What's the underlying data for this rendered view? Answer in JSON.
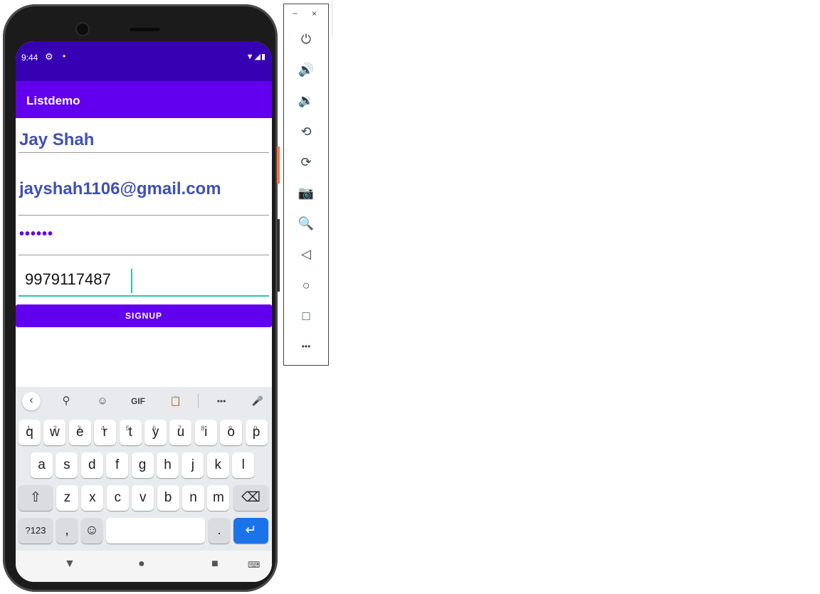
{
  "status_bar": {
    "time": "9:44",
    "settings_icon": "gear-icon",
    "dot": "•",
    "right_icons": "▼◢▮"
  },
  "app_bar": {
    "title": "Listdemo"
  },
  "form": {
    "name_value": "Jay Shah",
    "email_value": "jayshah1106@gmail.com",
    "password_value": "••••••",
    "phone_value": "9979117487",
    "signup_label": "SIGNUP"
  },
  "keyboard": {
    "toolbar": {
      "back": "‹",
      "search": "⚲",
      "sticker": "☺",
      "gif": "GIF",
      "clipboard": "📋",
      "more": "•••",
      "mic": "🎤"
    },
    "row1": [
      {
        "k": "q",
        "h": "1"
      },
      {
        "k": "w",
        "h": "2"
      },
      {
        "k": "e",
        "h": "3"
      },
      {
        "k": "r",
        "h": "4"
      },
      {
        "k": "t",
        "h": "5"
      },
      {
        "k": "y",
        "h": "6"
      },
      {
        "k": "u",
        "h": "7"
      },
      {
        "k": "i",
        "h": "8"
      },
      {
        "k": "o",
        "h": "9"
      },
      {
        "k": "p",
        "h": "0"
      }
    ],
    "row2": [
      "a",
      "s",
      "d",
      "f",
      "g",
      "h",
      "j",
      "k",
      "l"
    ],
    "row3": [
      "z",
      "x",
      "c",
      "v",
      "b",
      "n",
      "m"
    ],
    "shift": "⇧",
    "backspace": "⌫",
    "symbols": "?123",
    "comma": ",",
    "emoji": "☺",
    "period": ".",
    "enter": "↵"
  },
  "nav_bar": {
    "back": "▼",
    "home": "●",
    "recents": "■",
    "keyboard_switch": "⌨"
  },
  "emulator_panel": {
    "minimize": "−",
    "close": "×",
    "buttons": [
      "power-icon",
      "volume-up-icon",
      "volume-down-icon",
      "rotate-left-icon",
      "rotate-right-icon",
      "camera-icon",
      "zoom-icon",
      "back-icon",
      "home-icon",
      "overview-icon",
      "more-icon"
    ],
    "glyphs": [
      "⏻",
      "🔊",
      "🔉",
      "⟲",
      "⟳",
      "📷",
      "🔍",
      "◁",
      "○",
      "□",
      "•••"
    ]
  },
  "colors": {
    "status_bar": "#3700b3",
    "primary": "#6200ee",
    "input_text": "#3f51b5",
    "focus_underline": "#26c6b8",
    "enter_key": "#1a73e8"
  }
}
